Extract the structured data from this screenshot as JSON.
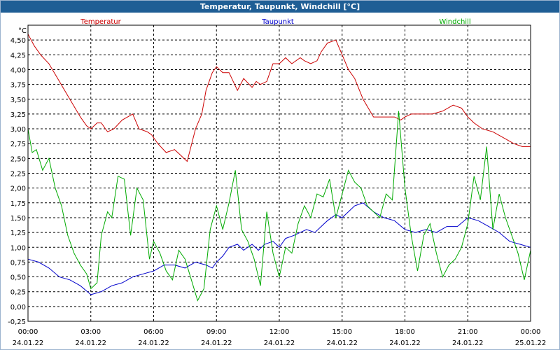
{
  "window": {
    "title": "Temperatur, Taupunkt, Windchill [°C]"
  },
  "chart_data": {
    "type": "line",
    "ylabel": "°C",
    "ylim": [
      -0.25,
      4.75
    ],
    "yticks": [
      -0.25,
      0.0,
      0.25,
      0.5,
      0.75,
      1.0,
      1.25,
      1.5,
      1.75,
      2.0,
      2.25,
      2.5,
      2.75,
      3.0,
      3.25,
      3.5,
      3.75,
      4.0,
      4.25,
      4.5
    ],
    "ytick_labels": [
      "-0,25",
      "0,00",
      "0,25",
      "0,50",
      "0,75",
      "1,00",
      "1,25",
      "1,50",
      "1,75",
      "2,00",
      "2,25",
      "2,50",
      "2,75",
      "3,00",
      "3,25",
      "3,50",
      "3,75",
      "4,00",
      "4,25",
      "4,50"
    ],
    "xlim": [
      0,
      24
    ],
    "xticks": [
      {
        "x": 0,
        "time": "00:00",
        "date": "24.01.22"
      },
      {
        "x": 3,
        "time": "03:00",
        "date": "24.01.22"
      },
      {
        "x": 6,
        "time": "06:00",
        "date": "24.01.22"
      },
      {
        "x": 9,
        "time": "09:00",
        "date": "24.01.22"
      },
      {
        "x": 12,
        "time": "12:00",
        "date": "24.01.22"
      },
      {
        "x": 15,
        "time": "15:00",
        "date": "24.01.22"
      },
      {
        "x": 18,
        "time": "18:00",
        "date": "24.01.22"
      },
      {
        "x": 21,
        "time": "21:00",
        "date": "24.01.22"
      },
      {
        "x": 24,
        "time": "00:00",
        "date": "25.01.22"
      }
    ],
    "grid": true,
    "legend_position": "top",
    "series": [
      {
        "name": "Temperatur",
        "color": "#cc0000",
        "x": [
          0,
          0.3,
          0.6,
          1.0,
          1.5,
          2.0,
          2.5,
          2.8,
          3.0,
          3.3,
          3.5,
          3.8,
          4.1,
          4.5,
          5.0,
          5.3,
          5.7,
          5.9,
          6.2,
          6.6,
          7.0,
          7.3,
          7.6,
          8.0,
          8.3,
          8.5,
          8.8,
          9.0,
          9.3,
          9.6,
          10.0,
          10.3,
          10.7,
          10.9,
          11.1,
          11.4,
          11.7,
          12.0,
          12.3,
          12.6,
          13.0,
          13.2,
          13.5,
          13.8,
          14.0,
          14.3,
          14.7,
          15.0,
          15.3,
          15.6,
          16.0,
          16.5,
          17.0,
          17.5,
          17.8,
          18.0,
          18.3,
          18.8,
          19.3,
          19.8,
          20.3,
          20.7,
          21.0,
          21.3,
          21.7,
          22.2,
          22.7,
          23.2,
          23.6,
          24.0
        ],
        "y": [
          4.6,
          4.4,
          4.25,
          4.1,
          3.8,
          3.5,
          3.2,
          3.05,
          3.0,
          3.1,
          3.1,
          2.95,
          3.0,
          3.15,
          3.25,
          3.0,
          2.95,
          2.9,
          2.75,
          2.6,
          2.65,
          2.55,
          2.45,
          3.0,
          3.25,
          3.65,
          3.95,
          4.05,
          3.95,
          3.95,
          3.65,
          3.85,
          3.7,
          3.8,
          3.75,
          3.8,
          4.1,
          4.1,
          4.2,
          4.1,
          4.2,
          4.15,
          4.1,
          4.15,
          4.3,
          4.45,
          4.5,
          4.25,
          4.0,
          3.85,
          3.5,
          3.2,
          3.2,
          3.2,
          3.15,
          3.2,
          3.25,
          3.25,
          3.25,
          3.3,
          3.4,
          3.35,
          3.2,
          3.1,
          3.0,
          2.95,
          2.85,
          2.75,
          2.7,
          2.7
        ]
      },
      {
        "name": "Taupunkt",
        "color": "#0000cc",
        "x": [
          0,
          0.5,
          1.0,
          1.5,
          2.0,
          2.5,
          3.0,
          3.5,
          4.0,
          4.5,
          5.0,
          5.5,
          6.0,
          6.5,
          7.0,
          7.5,
          8.0,
          8.5,
          8.8,
          9.0,
          9.3,
          9.6,
          10.0,
          10.3,
          10.7,
          11.0,
          11.3,
          11.7,
          12.0,
          12.3,
          12.7,
          13.0,
          13.3,
          13.7,
          14.0,
          14.3,
          14.7,
          15.0,
          15.3,
          15.6,
          16.0,
          16.5,
          17.0,
          17.5,
          18.0,
          18.5,
          19.0,
          19.5,
          20.0,
          20.5,
          21.0,
          21.5,
          22.0,
          22.5,
          23.0,
          23.5,
          24.0
        ],
        "y": [
          0.8,
          0.75,
          0.65,
          0.5,
          0.45,
          0.35,
          0.2,
          0.25,
          0.35,
          0.4,
          0.5,
          0.55,
          0.6,
          0.7,
          0.7,
          0.65,
          0.75,
          0.7,
          0.65,
          0.75,
          0.85,
          1.0,
          1.05,
          0.95,
          1.05,
          0.95,
          1.05,
          1.1,
          1.0,
          1.15,
          1.2,
          1.25,
          1.3,
          1.25,
          1.35,
          1.45,
          1.55,
          1.5,
          1.6,
          1.7,
          1.75,
          1.6,
          1.5,
          1.45,
          1.3,
          1.25,
          1.3,
          1.25,
          1.35,
          1.35,
          1.5,
          1.45,
          1.35,
          1.25,
          1.1,
          1.05,
          1.0
        ]
      },
      {
        "name": "Windchill",
        "color": "#00aa00",
        "x": [
          0,
          0.2,
          0.4,
          0.7,
          1.0,
          1.3,
          1.6,
          1.9,
          2.2,
          2.5,
          2.8,
          3.0,
          3.3,
          3.5,
          3.8,
          4.0,
          4.3,
          4.6,
          4.9,
          5.2,
          5.5,
          5.8,
          6.0,
          6.3,
          6.6,
          6.9,
          7.2,
          7.5,
          7.8,
          8.1,
          8.4,
          8.7,
          9.0,
          9.3,
          9.6,
          9.9,
          10.2,
          10.5,
          10.8,
          11.1,
          11.4,
          11.7,
          12.0,
          12.3,
          12.6,
          12.9,
          13.2,
          13.5,
          13.8,
          14.1,
          14.4,
          14.7,
          15.0,
          15.3,
          15.6,
          15.9,
          16.2,
          16.5,
          16.8,
          17.1,
          17.4,
          17.7,
          18.0,
          18.3,
          18.6,
          18.9,
          19.2,
          19.5,
          19.8,
          20.1,
          20.4,
          20.7,
          21.0,
          21.3,
          21.6,
          21.9,
          22.2,
          22.5,
          22.8,
          23.1,
          23.4,
          23.7,
          24.0
        ],
        "y": [
          3.0,
          2.6,
          2.65,
          2.3,
          2.5,
          2.0,
          1.7,
          1.2,
          0.9,
          0.7,
          0.55,
          0.3,
          0.4,
          1.2,
          1.6,
          1.5,
          2.2,
          2.15,
          1.2,
          2.0,
          1.8,
          0.8,
          1.1,
          0.9,
          0.6,
          0.45,
          0.95,
          0.8,
          0.45,
          0.1,
          0.3,
          1.3,
          1.7,
          1.3,
          1.75,
          2.3,
          1.3,
          1.1,
          0.8,
          0.35,
          1.6,
          0.9,
          0.5,
          1.0,
          0.9,
          1.4,
          1.7,
          1.5,
          1.9,
          1.85,
          2.15,
          1.5,
          1.9,
          2.3,
          2.1,
          2.0,
          1.7,
          1.6,
          1.5,
          1.9,
          1.8,
          3.3,
          2.0,
          1.2,
          0.6,
          1.2,
          1.4,
          0.9,
          0.5,
          0.7,
          0.8,
          1.0,
          1.4,
          2.2,
          1.8,
          2.7,
          1.3,
          1.9,
          1.5,
          1.2,
          0.9,
          0.45,
          0.95
        ]
      }
    ]
  }
}
